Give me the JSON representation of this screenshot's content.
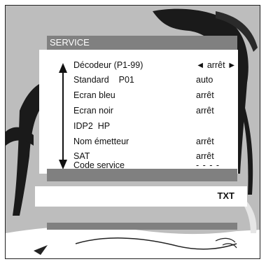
{
  "menu": {
    "title": "SERVICE",
    "items": [
      {
        "label": "Décodeur (P1-99)",
        "value": "◄ arrêt ►"
      },
      {
        "label": "Standard    P01",
        "value": "auto"
      },
      {
        "label": "Ecran bleu",
        "value": "arrêt"
      },
      {
        "label": "Ecran noir",
        "value": "arrêt"
      },
      {
        "label": "IDP2  HP",
        "value": ""
      },
      {
        "label": "Nom émetteur",
        "value": "arrêt"
      },
      {
        "label": "SAT",
        "value": "arrêt"
      },
      {
        "label": "Code service",
        "value": "- - - -"
      }
    ]
  },
  "footer": {
    "txt_label": "TXT"
  },
  "icons": {
    "scroll": "up-down-double-arrow-icon"
  },
  "colors": {
    "bar_gray": "#808080",
    "panel_white": "#ffffff",
    "backdrop_gray": "#bdbdbd"
  }
}
